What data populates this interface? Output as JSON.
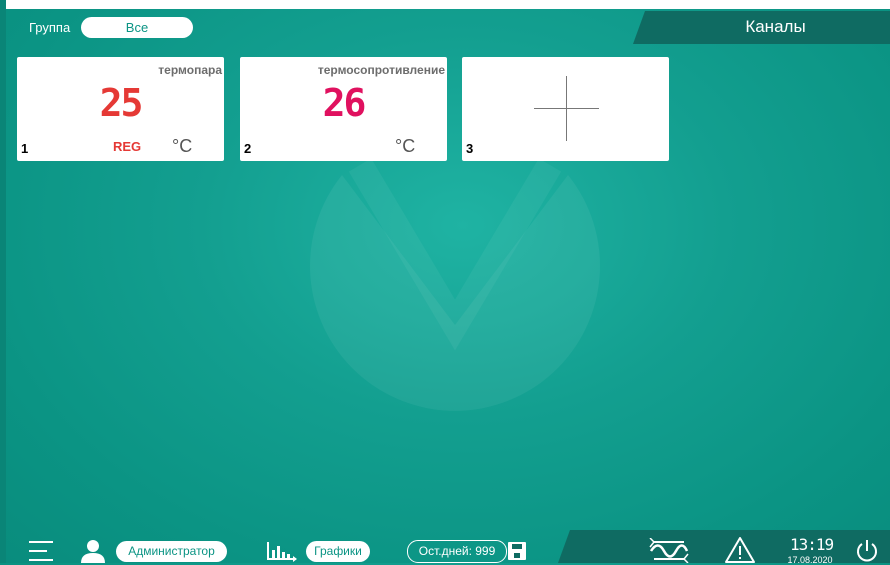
{
  "header": {
    "group_label": "Группа",
    "group_value": "Все",
    "section_title": "Каналы"
  },
  "channels": [
    {
      "index": "1",
      "sensor_type": "термопара",
      "value": "25",
      "mode": "REG",
      "unit": "°C",
      "value_color": "#e53935"
    },
    {
      "index": "2",
      "sensor_type": "термосопротивление",
      "value": "26",
      "mode": "",
      "unit": "°C",
      "value_color": "#e0115f"
    },
    {
      "index": "3",
      "sensor_type": "",
      "value": "",
      "mode": "",
      "unit": "",
      "state": "add-channel"
    }
  ],
  "footer": {
    "menu_icon": "menu-icon",
    "user_icon": "user-icon",
    "user_role": "Администратор",
    "charts_icon": "chart-icon",
    "charts_label": "Графики",
    "days_left": "Ост.дней: 999",
    "save_icon": "save-icon",
    "signal_icon": "wave-icon",
    "alarm_icon": "alarm-icon",
    "time": "13:19",
    "date": "17.08.2020",
    "power_icon": "power-icon"
  },
  "colors": {
    "background": "#0b9484",
    "dark_panel": "#0f6b62",
    "tile": "#ffffff"
  }
}
